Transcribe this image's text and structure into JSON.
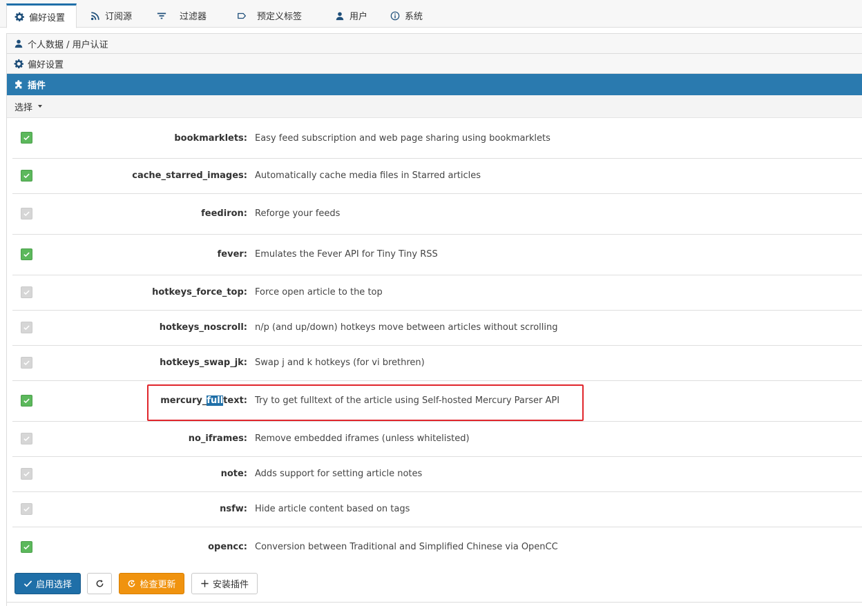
{
  "tabs": [
    {
      "label": "偏好设置",
      "icon": "gear-icon",
      "active": true
    },
    {
      "label": "订阅源",
      "icon": "rss-icon",
      "active": false
    },
    {
      "label": "过滤器",
      "icon": "filter-icon",
      "active": false
    },
    {
      "label": "预定义标签",
      "icon": "label-tag-icon",
      "active": false
    },
    {
      "label": "用户",
      "icon": "user-icon",
      "active": false
    },
    {
      "label": "系统",
      "icon": "info-icon",
      "active": false
    }
  ],
  "sections": {
    "personal": {
      "label": "个人数据 / 用户认证",
      "icon": "user-icon"
    },
    "prefs": {
      "label": "偏好设置",
      "icon": "gear-icon"
    },
    "plugins": {
      "label": "插件",
      "icon": "puzzle-icon"
    }
  },
  "select_menu": {
    "label": "选择"
  },
  "plugins": [
    {
      "name": "bookmarklets:",
      "desc": "Easy feed subscription and web page sharing using bookmarklets",
      "enabled": true
    },
    {
      "name": "cache_starred_images:",
      "desc": "Automatically cache media files in Starred articles",
      "enabled": true
    },
    {
      "name": "feediron:",
      "desc": "Reforge your feeds",
      "enabled": false
    },
    {
      "name": "fever:",
      "desc": "Emulates the Fever API for Tiny Tiny RSS",
      "enabled": true
    },
    {
      "name": "hotkeys_force_top:",
      "desc": "Force open article to the top",
      "enabled": false
    },
    {
      "name": "hotkeys_noscroll:",
      "desc": "n/p (and up/down) hotkeys move between articles without scrolling",
      "enabled": false
    },
    {
      "name": "hotkeys_swap_jk:",
      "desc": "Swap j and k hotkeys (for vi brethren)",
      "enabled": false
    },
    {
      "name_parts": [
        "mercury_",
        "full",
        "text:"
      ],
      "desc": "Try to get fulltext of the article using Self-hosted Mercury Parser API",
      "enabled": true,
      "highlighted": true
    },
    {
      "name": "no_iframes:",
      "desc": "Remove embedded iframes (unless whitelisted)",
      "enabled": false
    },
    {
      "name": "note:",
      "desc": "Adds support for setting article notes",
      "enabled": false
    },
    {
      "name": "nsfw:",
      "desc": "Hide article content based on tags",
      "enabled": false
    },
    {
      "name": "opencc:",
      "desc": "Conversion between Traditional and Simplified Chinese via OpenCC",
      "enabled": true
    }
  ],
  "buttons": {
    "enable_selected": "启用选择",
    "check_updates": "检查更新",
    "install_plugin": "安装插件"
  },
  "colors": {
    "accent": "#2a7aaf",
    "primary": "#1f6fa8",
    "enabled": "#5cb85c",
    "disabled": "#d6d6d6",
    "warning": "#f0930f",
    "highlight_box": "#e0252b"
  }
}
